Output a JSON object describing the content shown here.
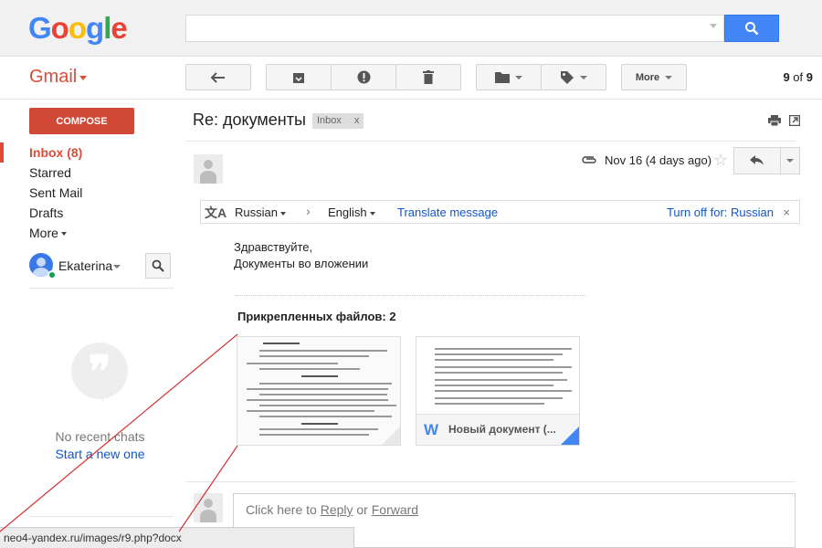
{
  "brand": {
    "logo_letters": [
      "G",
      "o",
      "o",
      "g",
      "l",
      "e"
    ],
    "app_label": "Gmail"
  },
  "search": {
    "value": "",
    "placeholder": ""
  },
  "toolbar": {
    "more_label": "More",
    "count_current": "9",
    "count_of": "of",
    "count_total": "9"
  },
  "sidebar": {
    "compose_label": "COMPOSE",
    "items": [
      {
        "label": "Inbox (8)"
      },
      {
        "label": "Starred"
      },
      {
        "label": "Sent Mail"
      },
      {
        "label": "Drafts"
      },
      {
        "label": "More"
      }
    ],
    "user_name": "Ekaterina",
    "no_chats": "No recent chats",
    "start_new": "Start a new one"
  },
  "message": {
    "subject": "Re: документы",
    "tag": "Inbox",
    "tag_close": "x",
    "date": "Nov 16 (4 days ago)",
    "body_lines": [
      "Здравствуйте,",
      "Документы во вложении"
    ],
    "attachments_title": "Прикрепленных файлов: 2",
    "attachments": [
      {
        "name": ""
      },
      {
        "name": "Новый документ (..."
      }
    ]
  },
  "translate": {
    "source": "Russian",
    "target": "English",
    "action": "Translate message",
    "turn_off": "Turn off for: Russian",
    "close": "×"
  },
  "reply": {
    "prefix": "Click here to ",
    "reply_link": "Reply",
    "or": " or ",
    "forward_link": "Forward"
  },
  "statusbar": {
    "url": "neo4-yandex.ru/images/r9.php?docx"
  },
  "colors": {
    "accent": "#dd4b39",
    "link": "#1155cc",
    "search_button": "#4285f4",
    "annotation": "#d32f2f"
  },
  "icons": [
    "search-icon",
    "back-arrow-icon",
    "archive-icon",
    "report-spam-icon",
    "delete-icon",
    "folder-icon",
    "label-icon",
    "print-icon",
    "new-window-icon",
    "paperclip-icon",
    "star-icon",
    "reply-icon",
    "translate-icon",
    "word-icon",
    "person-icon"
  ]
}
